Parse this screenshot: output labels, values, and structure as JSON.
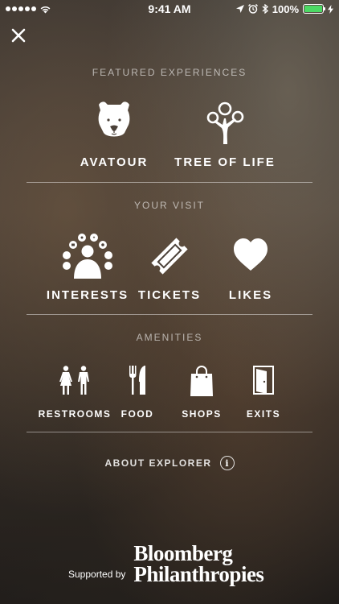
{
  "status_bar": {
    "time": "9:41 AM",
    "battery_percent": "100%",
    "signal_dots": 5,
    "icons": [
      "wifi-icon",
      "location-arrow-icon",
      "alarm-icon",
      "bluetooth-icon",
      "battery-icon",
      "charging-icon"
    ]
  },
  "close": {
    "icon": "close-icon"
  },
  "featured": {
    "header": "FEATURED EXPERIENCES",
    "items": [
      {
        "label": "AVATOUR",
        "icon": "bear-icon"
      },
      {
        "label": "TREE OF LIFE",
        "icon": "tree-icon"
      }
    ]
  },
  "visit": {
    "header": "YOUR VISIT",
    "items": [
      {
        "label": "INTERESTS",
        "icon": "interests-icon"
      },
      {
        "label": "TICKETS",
        "icon": "ticket-icon"
      },
      {
        "label": "LIKES",
        "icon": "heart-icon"
      }
    ]
  },
  "amenities": {
    "header": "AMENITIES",
    "items": [
      {
        "label": "RESTROOMS",
        "icon": "restroom-icon"
      },
      {
        "label": "FOOD",
        "icon": "fork-knife-icon"
      },
      {
        "label": "SHOPS",
        "icon": "shopping-bag-icon"
      },
      {
        "label": "EXITS",
        "icon": "exit-door-icon"
      }
    ]
  },
  "about": {
    "label": "ABOUT EXPLORER",
    "icon_glyph": "i"
  },
  "sponsor": {
    "label": "Supported by",
    "logo_line1": "Bloomberg",
    "logo_line2": "Philanthropies"
  }
}
